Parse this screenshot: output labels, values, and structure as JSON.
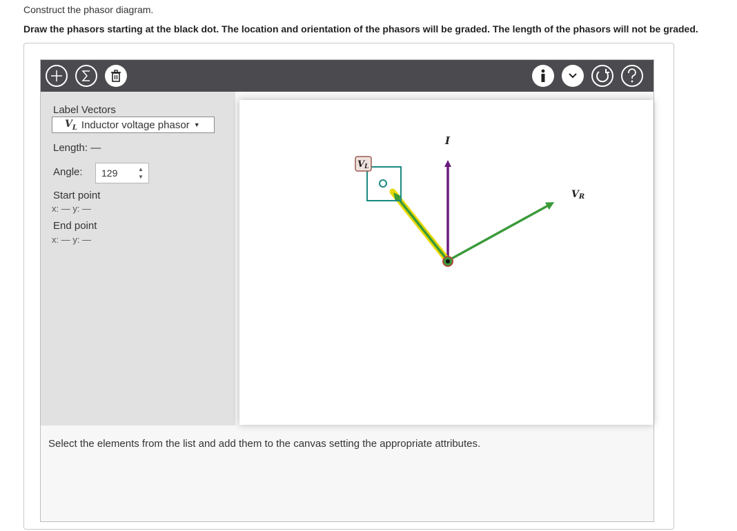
{
  "instructions": {
    "line1": "Construct the phasor diagram.",
    "line2": "Draw the phasors starting at the black dot. The location and orientation of the phasors will be graded. The length of the phasors will not be graded."
  },
  "toolbar": {
    "left_icons": [
      "plus-icon",
      "sigma-icon",
      "trash-icon"
    ],
    "right_icons": [
      "info-icon",
      "chevron-down-icon",
      "reset-icon",
      "help-icon"
    ]
  },
  "panel": {
    "label_vectors": "Label Vectors",
    "selected_symbol": "V",
    "selected_symbol_sub": "L",
    "selected_text": "Inductor voltage phasor",
    "length_label": "Length:",
    "length_value": "—",
    "angle_label": "Angle:",
    "angle_value": "129",
    "start_point_label": "Start point",
    "start_point_coords": "x: — y: —",
    "end_point_label": "End point",
    "end_point_coords": "x: — y: —"
  },
  "canvas": {
    "vectors": [
      {
        "label": "I",
        "sub": "",
        "color": "#6a1b7d"
      },
      {
        "label": "V",
        "sub": "R",
        "color": "#3a9a3a"
      },
      {
        "label": "V",
        "sub": "L",
        "color": "#3a9a3a",
        "selected": true,
        "highlight": "#e6d800"
      }
    ]
  },
  "footer": {
    "hint": "Select the elements from the list and add them to the canvas setting the appropriate attributes."
  },
  "colors": {
    "toolbar_bg": "#4a4a4f",
    "panel_bg": "#e1e1e1",
    "selection_box": "#1a8a80",
    "origin_ring": "#b04a3a"
  }
}
